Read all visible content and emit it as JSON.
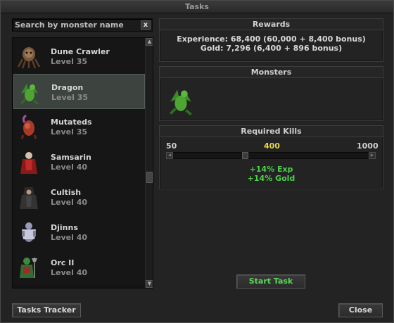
{
  "window": {
    "title": "Tasks"
  },
  "search": {
    "placeholder": "Search by monster name",
    "clear_label": "x"
  },
  "monsters": [
    {
      "name": "Dune Crawler",
      "level": "Level 35",
      "icon": "dune-crawler-icon"
    },
    {
      "name": "Dragon",
      "level": "Level 35",
      "icon": "dragon-icon",
      "selected": true
    },
    {
      "name": "Mutateds",
      "level": "Level 35",
      "icon": "mutated-icon"
    },
    {
      "name": "Samsarin",
      "level": "Level 40",
      "icon": "samsarin-icon"
    },
    {
      "name": "Cultish",
      "level": "Level 40",
      "icon": "cultist-icon"
    },
    {
      "name": "Djinns",
      "level": "Level 40",
      "icon": "djinn-icon"
    },
    {
      "name": "Orc II",
      "level": "Level 40",
      "icon": "orc-icon"
    }
  ],
  "rewards": {
    "title": "Rewards",
    "experience": "Experience: 68,400 (60,000 + 8,400 bonus)",
    "gold": "Gold: 7,296 (6,400 + 896 bonus)"
  },
  "monsters_panel": {
    "title": "Monsters",
    "icon": "dragon-icon"
  },
  "kills": {
    "title": "Required Kills",
    "min": "50",
    "current": "400",
    "max": "1000",
    "value": 400,
    "range": [
      50,
      1000
    ],
    "bonus_exp": "+14% Exp",
    "bonus_gold": "+14% Gold"
  },
  "buttons": {
    "start_task": "Start Task",
    "tasks_tracker": "Tasks Tracker",
    "close": "Close"
  },
  "colors": {
    "bonus_green": "#4bd04b",
    "current_yellow": "#e6d54a",
    "selected_row": "#3d4440"
  }
}
